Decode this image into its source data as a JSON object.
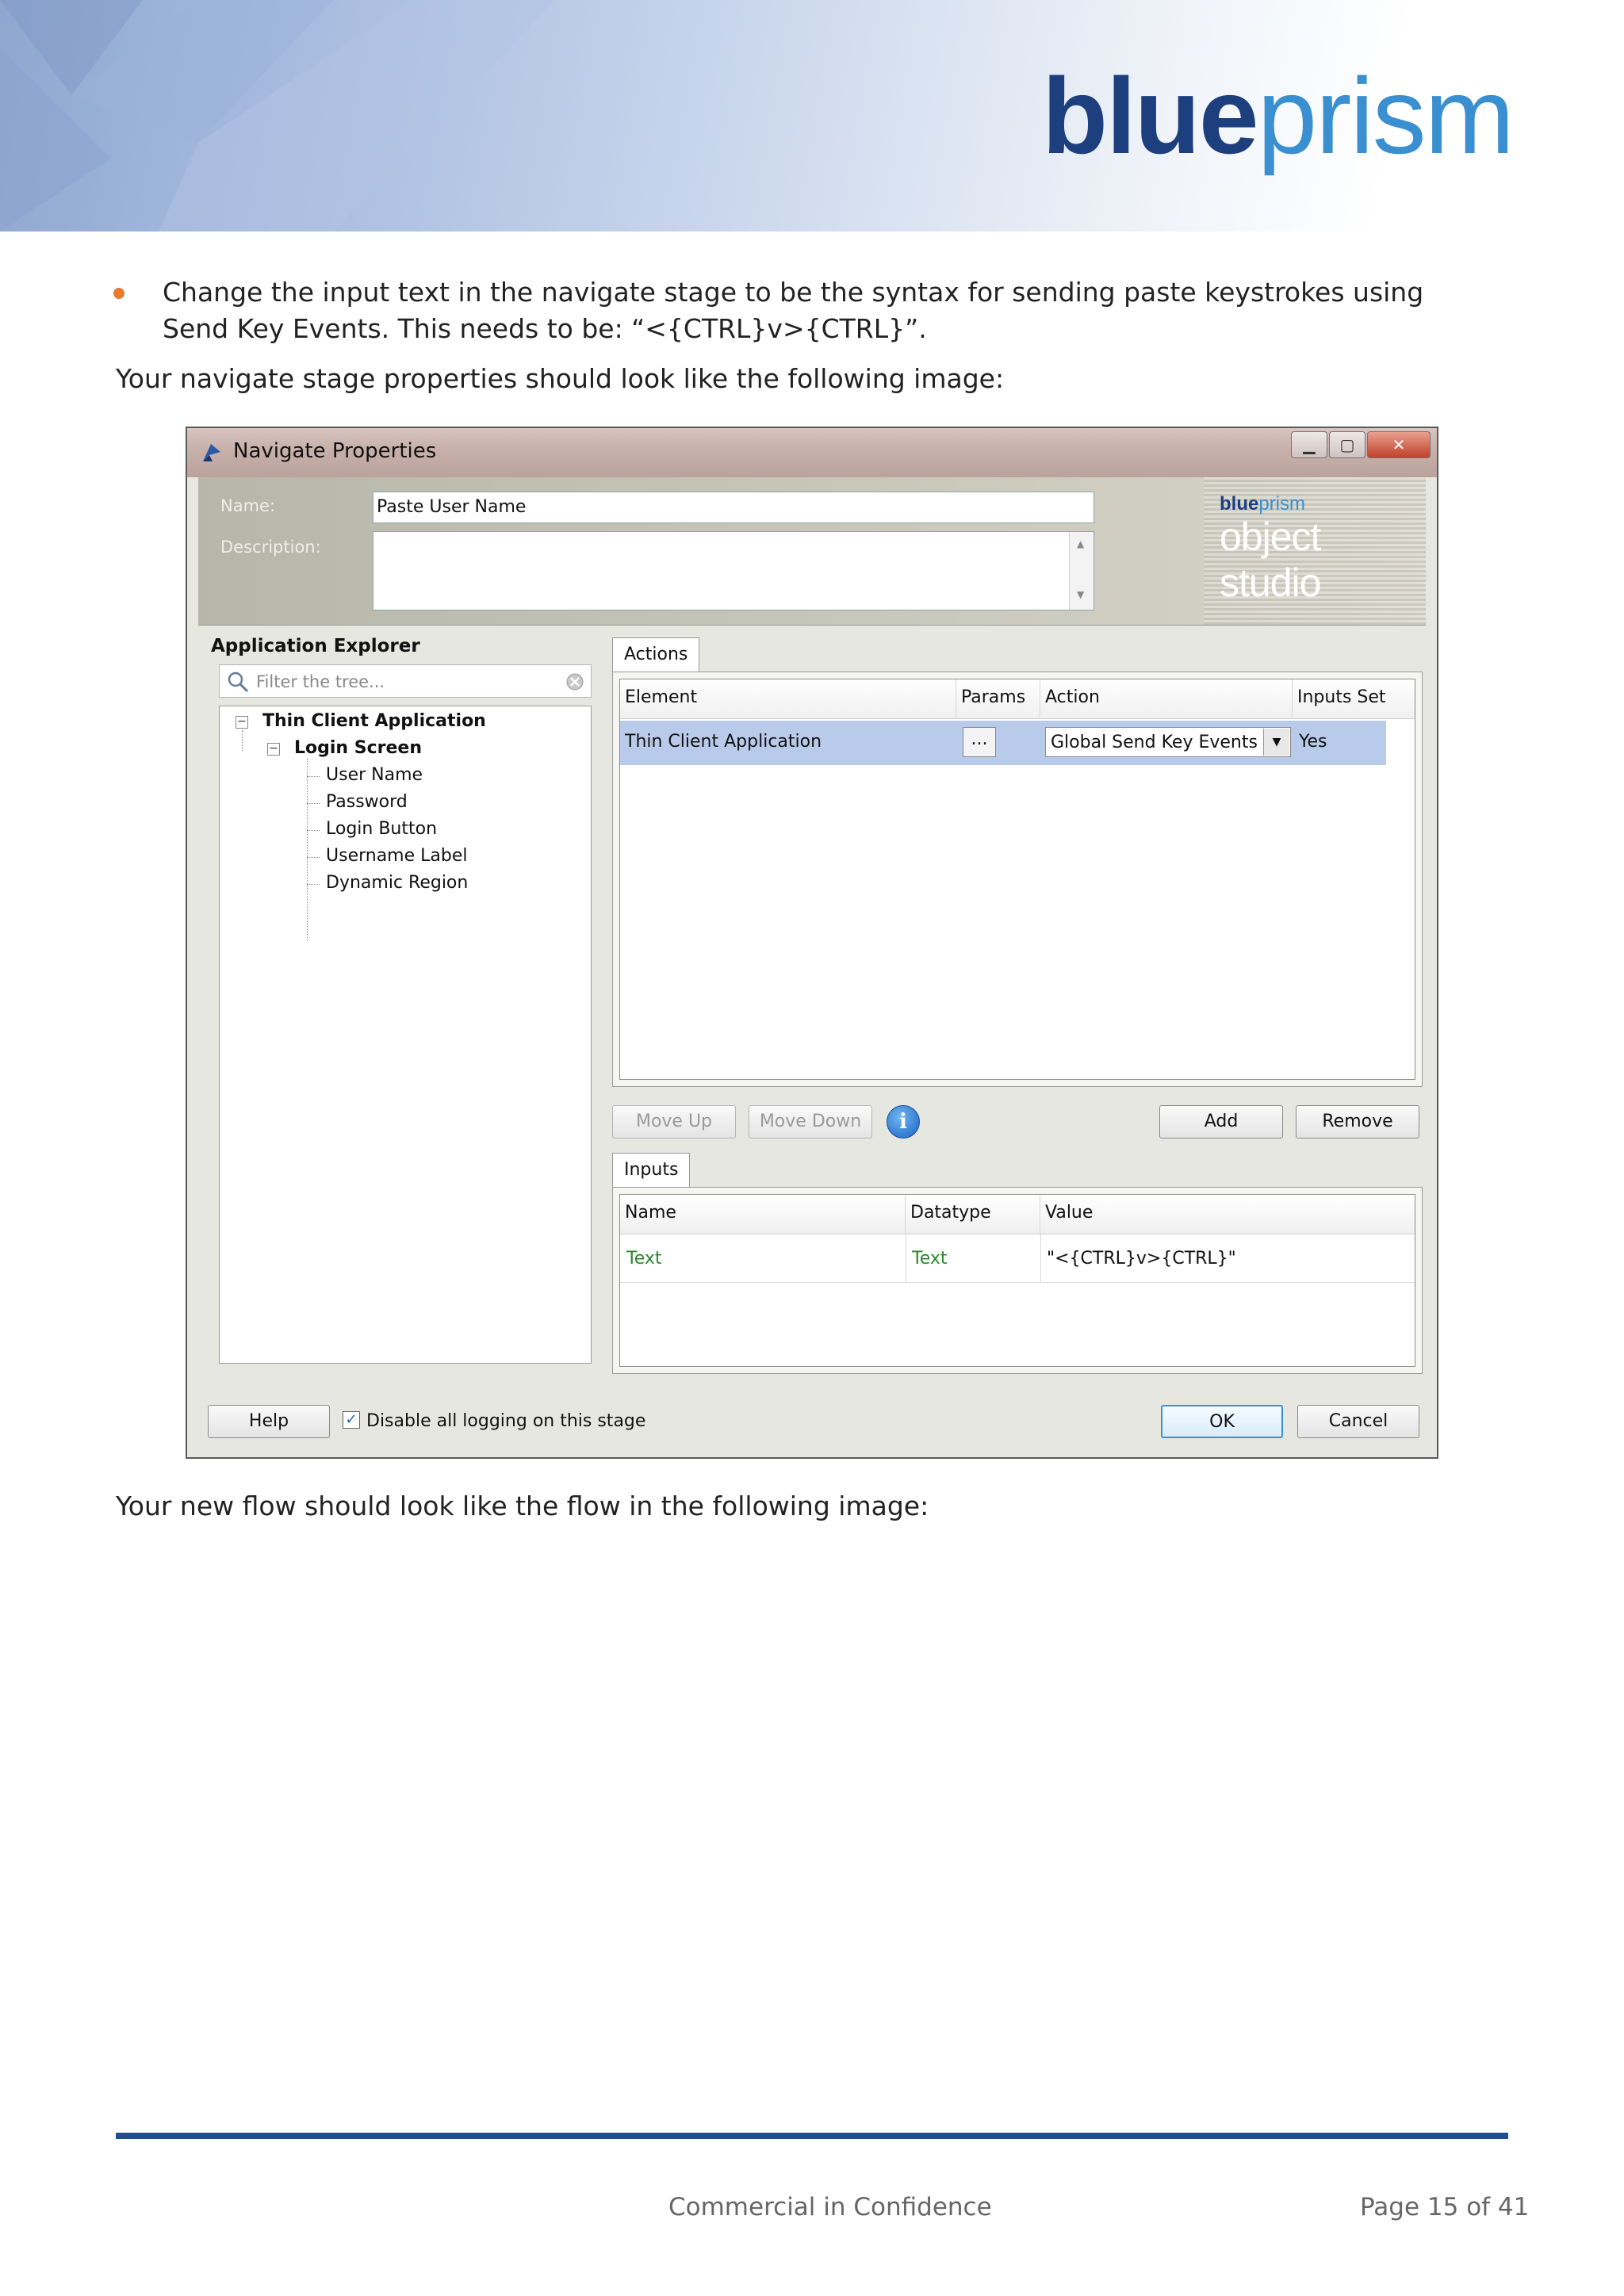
{
  "header": {
    "logo_part1": "blue",
    "logo_part2": "prism"
  },
  "body": {
    "bullet_text": "Change the input text in the navigate stage to be the syntax for sending paste keystrokes using Send Key Events.  This needs to be: “<{CTRL}v>{CTRL}”.",
    "para1": "Your navigate stage properties should look like the following image:",
    "para2": "Your new flow should look like the flow in the following image:"
  },
  "dialog": {
    "title": "Navigate Properties",
    "window_buttons": {
      "minimize": "▁",
      "maximize": "▢",
      "close": "✕"
    },
    "name_label": "Name:",
    "name_value": "Paste User Name",
    "description_label": "Description:",
    "description_value": "",
    "brand_small_1": "blue",
    "brand_small_2": "prism",
    "brand_studio": "object studio",
    "app_explorer": {
      "title": "Application Explorer",
      "filter_placeholder": "Filter the tree...",
      "root": "Thin Client Application",
      "screen": "Login Screen",
      "elements": [
        "User Name",
        "Password",
        "Login Button",
        "Username Label",
        "Dynamic Region"
      ]
    },
    "actions": {
      "tab": "Actions",
      "columns": [
        "Element",
        "Params",
        "Action",
        "Inputs Set"
      ],
      "rows": [
        {
          "element": "Thin Client Application",
          "params": "...",
          "action": "Global Send Key Events",
          "inputs_set": "Yes"
        }
      ]
    },
    "buttons": {
      "move_up": "Move Up",
      "move_down": "Move Down",
      "add": "Add",
      "remove": "Remove",
      "help": "Help",
      "ok": "OK",
      "cancel": "Cancel"
    },
    "inputs": {
      "tab": "Inputs",
      "columns": [
        "Name",
        "Datatype",
        "Value"
      ],
      "rows": [
        {
          "name": "Text",
          "datatype": "Text",
          "value": "\"<{CTRL}v>{CTRL}\""
        }
      ]
    },
    "logging_checkbox": {
      "label": "Disable all logging on this stage",
      "checked": true,
      "mark": "✓"
    },
    "icons": {
      "filter": "search-icon",
      "clear": "clear-icon",
      "info": "info-icon",
      "dropdown": "▼",
      "info_glyph": "i"
    },
    "colors": {
      "selection": "#b9cbea",
      "input_text": "#2a8a2a",
      "accent": "#3c8fd0"
    }
  },
  "footer": {
    "center": "Commercial in Confidence",
    "page": "Page 15 of 41"
  }
}
